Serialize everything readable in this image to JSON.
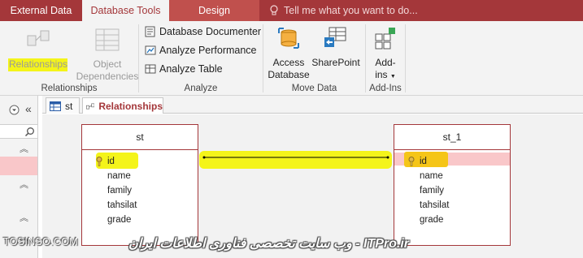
{
  "ribbon_tabs": {
    "external_data": "External Data",
    "database_tools": "Database Tools",
    "design": "Design",
    "tell_me": "Tell me what you want to do..."
  },
  "groups": {
    "relationships": {
      "label": "Relationships",
      "relationships_btn": "Relationships",
      "object_dependencies_line1": "Object",
      "object_dependencies_line2": "Dependencies"
    },
    "analyze": {
      "label": "Analyze",
      "database_documenter": "Database Documenter",
      "analyze_performance": "Analyze Performance",
      "analyze_table": "Analyze Table"
    },
    "move_data": {
      "label": "Move Data",
      "access_database_line1": "Access",
      "access_database_line2": "Database",
      "sharepoint": "SharePoint"
    },
    "addins": {
      "label": "Add-Ins",
      "addins_line1": "Add-",
      "addins_line2": "ins"
    }
  },
  "doc_tabs": {
    "st": "st",
    "relationships": "Relationships"
  },
  "tables": {
    "left": {
      "title": "st",
      "fields": [
        "id",
        "name",
        "family",
        "tahsilat",
        "grade"
      ]
    },
    "right": {
      "title": "st_1",
      "fields": [
        "id",
        "name",
        "family",
        "tahsilat",
        "grade"
      ]
    }
  },
  "watermarks": {
    "left": "TOSINSO.COM",
    "right": "ITPro.ir - وب سایت تخصصی فناوری اطلاعات ایران"
  },
  "colors": {
    "accent": "#a4373a",
    "highlight": "#f4f41a",
    "selected_row": "#f9c7c9"
  }
}
